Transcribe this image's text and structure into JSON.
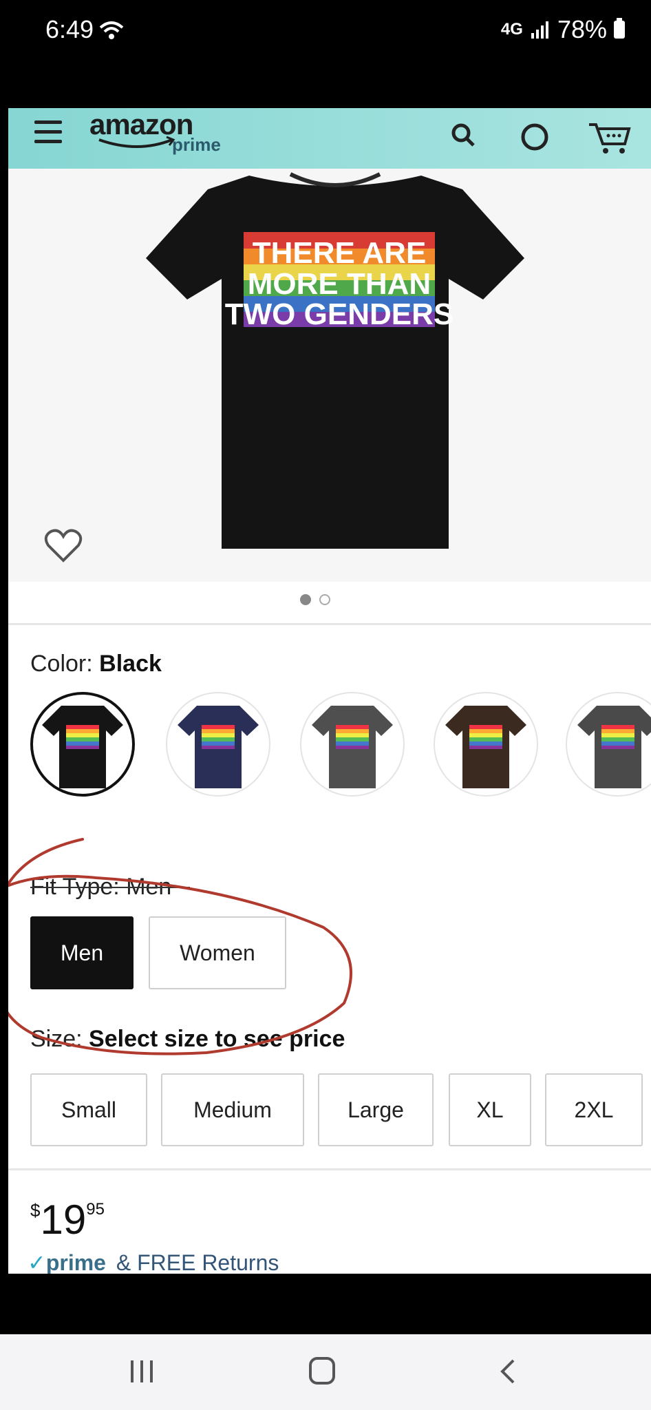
{
  "status_bar": {
    "time": "6:49",
    "network": "4G",
    "battery": "78%"
  },
  "header": {
    "logo_text": "amazon",
    "logo_sub": "prime",
    "icons": [
      "menu-icon",
      "search-icon",
      "alexa-icon",
      "cart-icon"
    ]
  },
  "product": {
    "shirt_text": [
      "THERE ARE",
      "MORE THAN",
      "TWO GENDERS"
    ],
    "image_count": 2,
    "active_image": 1
  },
  "color": {
    "label": "Color:",
    "value": "Black",
    "swatches": [
      "Black",
      "Navy",
      "Gray",
      "Brown",
      "Dark Gray"
    ],
    "swatch_colors": [
      "#151515",
      "#2a2f57",
      "#4f4f4f",
      "#3a2a20",
      "#4a4a4a"
    ]
  },
  "fit_type": {
    "label": "Fit Type: Men",
    "options": [
      "Men",
      "Women"
    ],
    "selected": "Men"
  },
  "size": {
    "label": "Size:",
    "prompt": "Select size to see price",
    "options": [
      "Small",
      "Medium",
      "Large",
      "XL",
      "2XL"
    ]
  },
  "price": {
    "currency": "$",
    "whole": "19",
    "fraction": "95"
  },
  "shipping": {
    "prime": "prime",
    "text": "& FREE Returns"
  },
  "annotation": {
    "color": "#b03a2e"
  }
}
